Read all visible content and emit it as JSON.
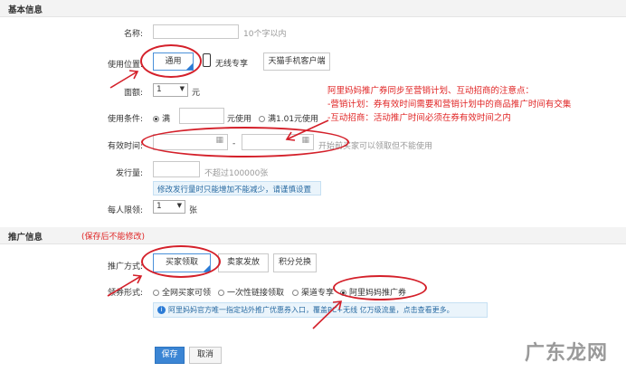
{
  "sections": {
    "basic_title": "基本信息",
    "promo_title": "推广信息",
    "promo_note": "(保存后不能修改)"
  },
  "fields": {
    "name_label": "名称:",
    "name_hint": "10个字以内",
    "position_label": "使用位置:",
    "position_options": [
      "通用",
      "无线专享",
      "天猫手机客户端"
    ],
    "denom_label": "面额:",
    "denom_value": "1",
    "denom_unit": "元",
    "condition_label": "使用条件:",
    "condition_full": "满",
    "condition_use": "元使用",
    "condition_alt": "满1.01元使用",
    "validity_label": "有效时间:",
    "validity_sep": "-",
    "validity_hint": "开始前买家可以领取但不能使用",
    "issue_label": "发行量:",
    "issue_hint": "不超过100000张",
    "issue_tip": "修改发行量时只能增加不能减少，请谨慎设置",
    "limit_label": "每人限领:",
    "limit_value": "1",
    "limit_unit": "张",
    "method_label": "推广方式:",
    "method_options": [
      "买家领取",
      "卖家发放",
      "积分兑换"
    ],
    "form_label": "领券形式:",
    "form_options": [
      "全网买家可领",
      "一次性链接领取",
      "渠道专享",
      "阿里妈妈推广券"
    ],
    "ali_tip": "阿里妈妈官方唯一指定站外推广优惠券入口，覆盖PC+无线 亿万级流量，点击查看更多。"
  },
  "annotation": {
    "line1": "阿里妈妈推广券同步至营销计划、互动招商的注意点：",
    "line2": "-营销计划：券有效时间需要和营销计划中的商品推广时间有交集",
    "line3": "-互动招商：活动推广时间必须在券有效时间之内"
  },
  "actions": {
    "save": "保存",
    "cancel": "取消"
  },
  "watermark": "广东龙网",
  "colors": {
    "annotation_red": "#e02424",
    "primary_blue": "#3b85d4"
  }
}
